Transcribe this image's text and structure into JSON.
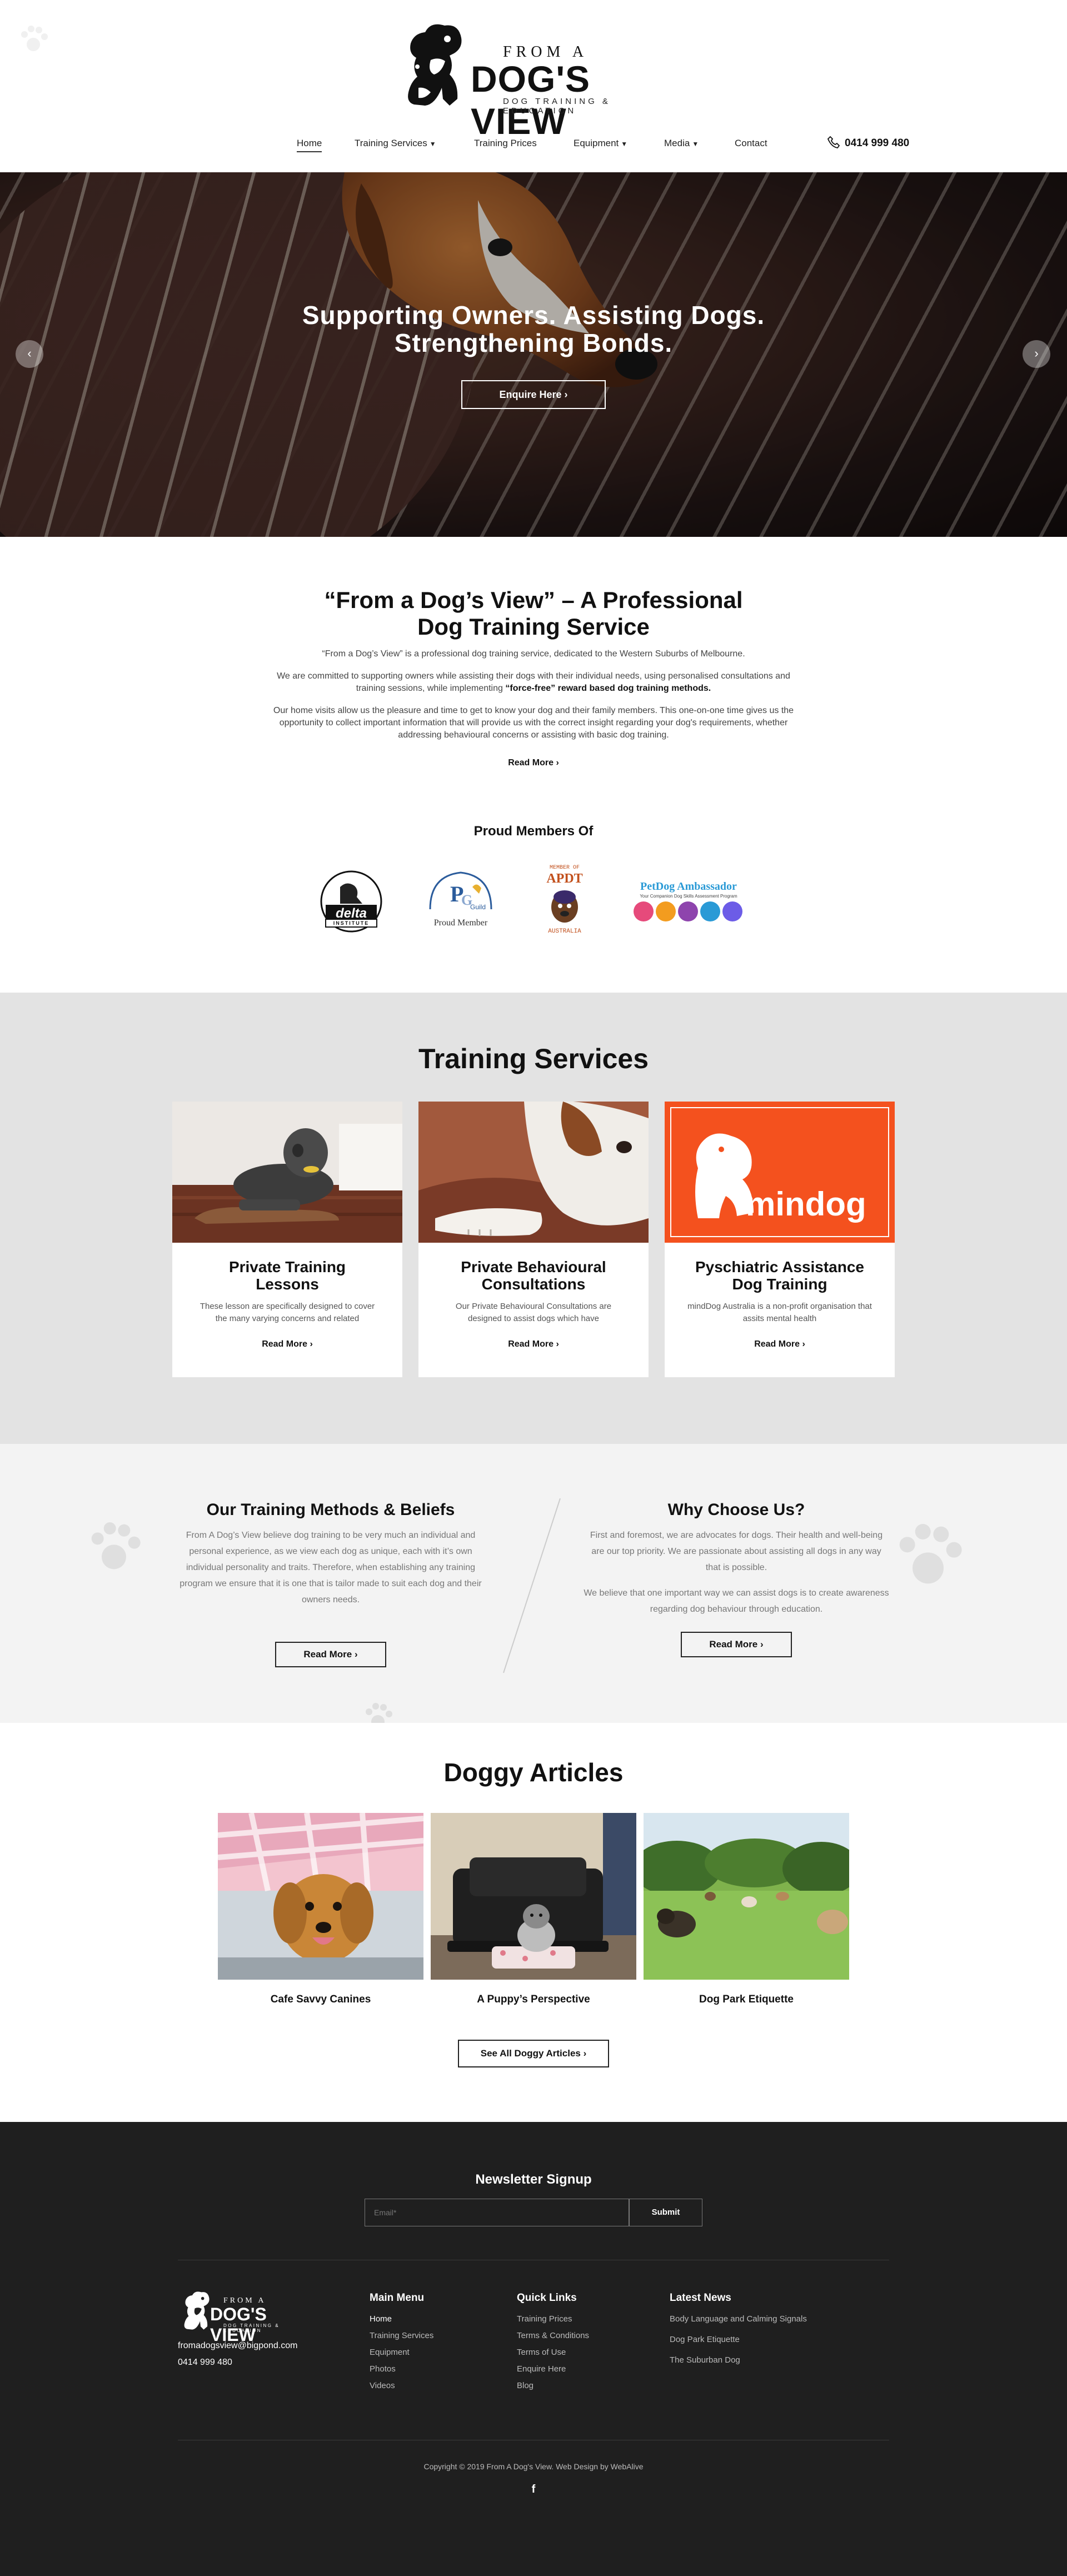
{
  "header": {
    "logo": {
      "line1": "FROM A",
      "line2": "DOG'S VIEW",
      "line3": "DOG TRAINING & EDUCATION"
    },
    "nav": [
      {
        "label": "Home",
        "active": true,
        "has_dropdown": false
      },
      {
        "label": "Training Services",
        "active": false,
        "has_dropdown": true
      },
      {
        "label": "Training Prices",
        "active": false,
        "has_dropdown": false
      },
      {
        "label": "Equipment",
        "active": false,
        "has_dropdown": true
      },
      {
        "label": "Media",
        "active": false,
        "has_dropdown": true
      },
      {
        "label": "Contact",
        "active": false,
        "has_dropdown": false
      }
    ],
    "phone": "0414 999 480"
  },
  "hero": {
    "headline_line1": "Supporting Owners. Assisting Dogs.",
    "headline_line2": "Strengthening Bonds.",
    "cta": "Enquire Here",
    "prev_icon": "chevron-left-icon",
    "next_icon": "chevron-right-icon"
  },
  "intro": {
    "title_line1": "“From a Dog’s View” – A Professional",
    "title_line2": "Dog Training Service",
    "p1": "“From a Dog’s View” is a professional dog training service, dedicated to the Western Suburbs of Melbourne.",
    "p2_a": "We are committed to supporting owners while assisting their dogs with their individual needs, using personalised consultations and training sessions, while implementing ",
    "p2_b": "“force-free” reward based dog training methods.",
    "p3": "Our home visits allow us the pleasure and time to get to know your dog and their family members. This one-on-one time gives us the opportunity to collect important information that will provide us with the correct insight regarding your dog's requirements, whether addressing behavioural concerns or assisting with basic dog training.",
    "read_more": "Read More",
    "proud_title": "Proud Members Of",
    "badges": [
      {
        "name": "Delta Institute",
        "text": "delta",
        "sub": "INSTITUTE"
      },
      {
        "name": "Pet Professional Guild",
        "text": "Proud Member",
        "sub": "The Association for Force Free Pet Professionals"
      },
      {
        "name": "APDT Australia",
        "text": "APDT",
        "sub": "AUSTRALIA",
        "top": "MEMBER OF"
      },
      {
        "name": "PetDog Ambassador",
        "text": "PetDog Ambassador",
        "sub": "Your Companion Dog Skills Assessment Program"
      }
    ]
  },
  "services": {
    "title": "Training Services",
    "cards": [
      {
        "title_line1": "Private Training",
        "title_line2": "Lessons",
        "text": "These lesson are specifically designed to cover the many varying concerns and related",
        "read_more": "Read More"
      },
      {
        "title_line1": "Private Behavioural",
        "title_line2": "Consultations",
        "text": "Our Private Behavioural Consultations are designed to assist dogs which have",
        "read_more": "Read More"
      },
      {
        "title_line1": "Pyschiatric Assistance",
        "title_line2": "Dog Training",
        "text": "mindDog Australia is a non-profit organisation that assits mental health",
        "read_more": "Read More",
        "logo_text": "mindog"
      }
    ]
  },
  "methods": {
    "left_title": "Our Training Methods & Beliefs",
    "left_text": "From A Dog’s View believe dog training to be very much an individual and personal experience, as we view each dog as unique, each with it’s own individual personality and traits. Therefore, when establishing any training program we ensure that it is one that is tailor made to suit each dog and their owners needs.",
    "left_btn": "Read More",
    "right_title": "Why Choose Us?",
    "right_text1": "First and foremost, we are advocates for dogs. Their health and well-being are our top priority. We are passionate about assisting all dogs in any way that is possible.",
    "right_text2": "We believe that one important way we can assist dogs is to create awareness regarding dog behaviour through education.",
    "right_btn": "Read More"
  },
  "articles": {
    "title": "Doggy Articles",
    "items": [
      {
        "title": "Cafe Savvy Canines"
      },
      {
        "title": "A Puppy’s Perspective"
      },
      {
        "title": "Dog Park Etiquette"
      }
    ],
    "see_all": "See All Doggy Articles"
  },
  "footer": {
    "newsletter_title": "Newsletter Signup",
    "email_placeholder": "Email*",
    "submit": "Submit",
    "email": "fromadogsview@bigpond.com",
    "phone": "0414 999 480",
    "main_menu": {
      "title": "Main Menu",
      "links": [
        "Home",
        "Training Services",
        "Equipment",
        "Photos",
        "Videos"
      ]
    },
    "quick_links": {
      "title": "Quick Links",
      "links": [
        "Training Prices",
        "Terms & Conditions",
        "Terms of Use",
        "Enquire Here",
        "Blog"
      ]
    },
    "latest_news": {
      "title": "Latest News",
      "links": [
        "Body Language and Calming Signals",
        "Dog Park Etiquette",
        "The Suburban Dog"
      ]
    },
    "copyright": "Copyright © 2019 From A Dog's View. Web Design by WebAlive",
    "social_icon": "facebook-icon"
  },
  "colors": {
    "footer_bg": "#1f1f1f",
    "services_bg": "#e3e3e3",
    "methods_bg": "#f3f3f3",
    "mindog_orange": "#f4511e"
  }
}
